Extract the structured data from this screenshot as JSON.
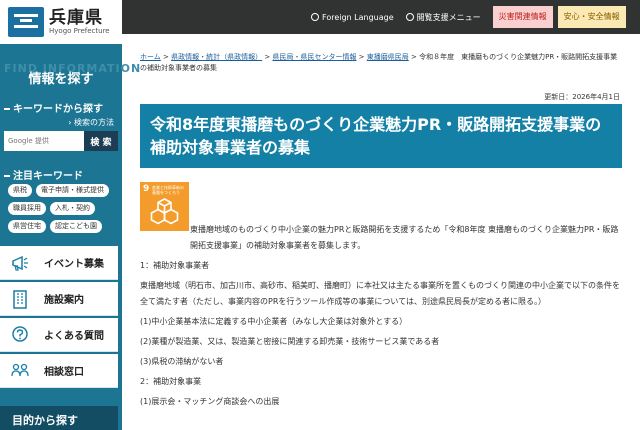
{
  "header": {
    "logo_name": "兵庫県",
    "logo_sub": "Hyogo Prefecture",
    "foreign_language": "Foreign Language",
    "reading_menu": "閲覧支援メニュー",
    "disaster_button": "災害関連情報",
    "safety_button": "安心・安全情報"
  },
  "sidebar": {
    "find_bg": "FIND INFORMATION",
    "info_title": "情報を探す",
    "keyword_heading": "キーワードから探す",
    "search_method": "› 検索の方法",
    "search_placeholder": "Google 提供",
    "search_button": "検 索",
    "featured_heading": "注目キーワード",
    "tags": [
      "県税",
      "電子申請・様式提供",
      "職員採用",
      "入札・契約",
      "県営住宅",
      "認定こども園"
    ],
    "menu": [
      {
        "label": "イベント募集",
        "icon": "megaphone-icon"
      },
      {
        "label": "施設案内",
        "icon": "building-icon"
      },
      {
        "label": "よくある質問",
        "icon": "question-bubble-icon"
      },
      {
        "label": "相談窓口",
        "icon": "people-icon"
      }
    ],
    "purpose": "目的から探す"
  },
  "main": {
    "breadcrumb": [
      {
        "text": "ホーム",
        "link": true
      },
      {
        "text": " > ",
        "link": false
      },
      {
        "text": "県政情報・統計（県政情報）",
        "link": true
      },
      {
        "text": " > ",
        "link": false
      },
      {
        "text": "県民局・県民センター情報",
        "link": true
      },
      {
        "text": " > ",
        "link": false
      },
      {
        "text": "東播磨県民局",
        "link": true
      },
      {
        "text": " > 令和８年度　東播磨ものづくり企業魅力PR・販路開拓支援事業の補助対象事業者の募集",
        "link": false
      }
    ],
    "updated": "更新日：2026年4月1日",
    "title": "令和8年度東播磨ものづくり企業魅力PR・販路開拓支援事業の補助対象事業者の募集",
    "sdg_number": "9",
    "sdg_text": "産業と技術革新の基盤をつくろう",
    "paragraphs": [
      "東播磨地域のものづくり中小企業の魅力PRと販路開拓を支援するため「令和8年度 東播磨ものづくり企業魅力PR・販路開拓支援事業」の補助対象事業者を募集します。",
      "1：補助対象事業者",
      "東播磨地域（明石市、加古川市、高砂市、稲美町、播磨町）に本社又は主たる事業所を置くものづくり関連の中小企業で以下の条件を全て満たす者（ただし、事業内容のPRを行うツール作成等の事業については、別途県民局長が定める者に限る。）",
      "(1)中小企業基本法に定義する中小企業者（みなし大企業は対象外とする）",
      "(2)業種が製造業、又は、製造業と密接に関連する卸売業・技術サービス業である者",
      "(3)県税の滞納がない者",
      "2：補助対象事業",
      "(1)展示会・マッチング商談会への出展"
    ]
  }
}
